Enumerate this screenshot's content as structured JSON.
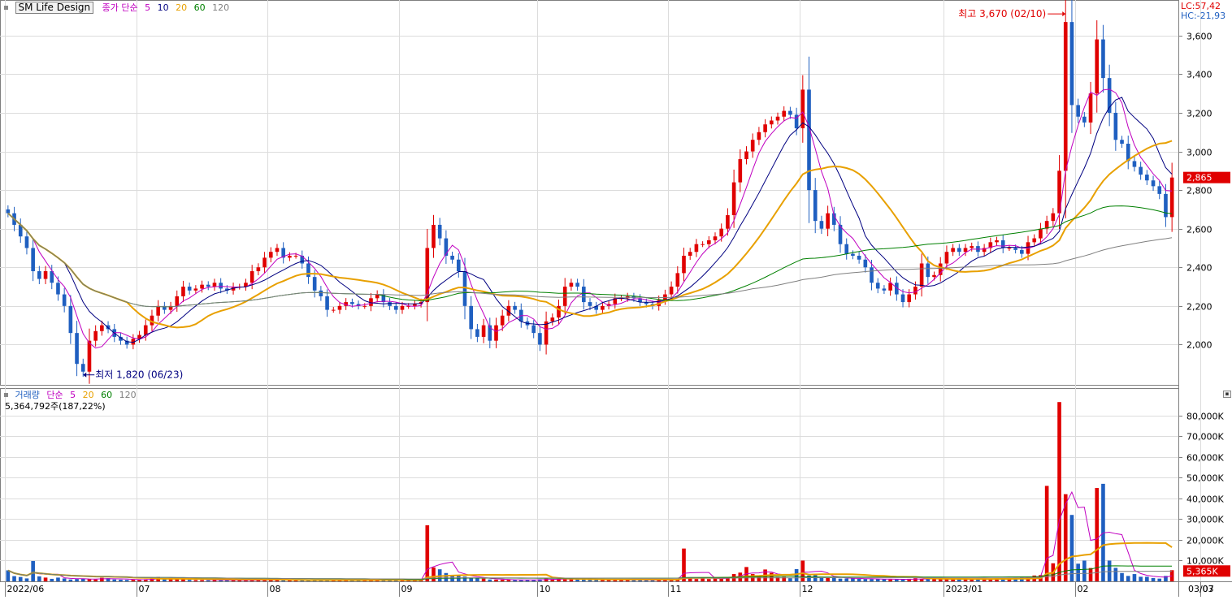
{
  "price_panel": {
    "title": "SM Life Design",
    "ma_label": "종가 단순",
    "ma_periods": [
      "5",
      "10",
      "20",
      "60",
      "120"
    ],
    "ma_colors": [
      "#c000c0",
      "#000080",
      "#e8a000",
      "#008000",
      "#808080"
    ],
    "lc_label": "LC:57,42",
    "hc_label": "HC:-21,93",
    "last_price_label": "2,865",
    "high_annotation": "최고 3,670 (02/10)",
    "low_annotation": "최저 1,820 (06/23)"
  },
  "volume_panel": {
    "title": "거래량",
    "ma_label": "단순",
    "ma_periods": [
      "5",
      "20",
      "60",
      "120"
    ],
    "ma_colors": [
      "#c000c0",
      "#e8a000",
      "#008000",
      "#808080"
    ],
    "volume_summary": "5,364,792주(187,22%)",
    "last_volume_label": "5,365K"
  },
  "colors": {
    "up": "#e00000",
    "down": "#1f5fc0",
    "badge": "#e00000"
  },
  "chart_data": [
    {
      "type": "candlestick",
      "title": "SM Life Design",
      "y_ticks": [
        "3,600",
        "3,400",
        "3,200",
        "3,000",
        "2,800",
        "2,600",
        "2,400",
        "2,200",
        "2,000"
      ],
      "ylim": [
        1800,
        3700
      ],
      "x_tick_labels": [
        "2022/06",
        "07",
        "08",
        "09",
        "10",
        "11",
        "12",
        "2023/01",
        "02",
        "03",
        "03/07"
      ],
      "grid": true,
      "series": [
        {
          "name": "5",
          "values": []
        },
        {
          "name": "10",
          "values": []
        },
        {
          "name": "20",
          "values": []
        },
        {
          "name": "60",
          "values": []
        },
        {
          "name": "120",
          "values": []
        }
      ],
      "close": [
        2680,
        2620,
        2560,
        2500,
        2380,
        2340,
        2380,
        2320,
        2260,
        2200,
        2060,
        1900,
        1860,
        2020,
        2070,
        2100,
        2080,
        2040,
        2020,
        2000,
        2030,
        2050,
        2100,
        2150,
        2200,
        2180,
        2200,
        2250,
        2300,
        2280,
        2290,
        2310,
        2300,
        2320,
        2290,
        2280,
        2300,
        2300,
        2320,
        2380,
        2400,
        2450,
        2480,
        2500,
        2450,
        2460,
        2460,
        2420,
        2350,
        2280,
        2250,
        2180,
        2180,
        2200,
        2220,
        2210,
        2200,
        2200,
        2240,
        2260,
        2220,
        2200,
        2180,
        2200,
        2200,
        2210,
        2220,
        2500,
        2620,
        2550,
        2460,
        2440,
        2380,
        2200,
        2080,
        2040,
        2100,
        2020,
        2100,
        2150,
        2200,
        2180,
        2120,
        2100,
        2060,
        2000,
        2120,
        2140,
        2200,
        2300,
        2320,
        2300,
        2220,
        2200,
        2180,
        2200,
        2210,
        2240,
        2240,
        2250,
        2240,
        2220,
        2210,
        2200,
        2230,
        2260,
        2300,
        2370,
        2460,
        2480,
        2520,
        2520,
        2540,
        2560,
        2600,
        2670,
        2840,
        2960,
        3000,
        3060,
        3100,
        3140,
        3160,
        3180,
        3210,
        3190,
        3120,
        3320,
        2800,
        2640,
        2600,
        2680,
        2620,
        2520,
        2470,
        2460,
        2440,
        2400,
        2320,
        2290,
        2280,
        2320,
        2260,
        2220,
        2260,
        2300,
        2420,
        2350,
        2360,
        2420,
        2480,
        2500,
        2480,
        2500,
        2510,
        2480,
        2500,
        2530,
        2540,
        2500,
        2500,
        2490,
        2470,
        2530,
        2550,
        2600,
        2640,
        2680,
        2900,
        3670,
        3240,
        3180,
        3150,
        3300,
        3580,
        3380,
        3200,
        3060,
        3040,
        2950,
        2920,
        2880,
        2850,
        2820,
        2780,
        2660,
        2865
      ],
      "volume": [
        5300,
        2500,
        2100,
        1400,
        9800,
        2400,
        1800,
        1200,
        1800,
        1400,
        900,
        1100,
        1300,
        1000,
        900,
        1700,
        1500,
        900,
        800,
        700,
        700,
        900,
        1000,
        1300,
        2100,
        1400,
        1600,
        1300,
        1600,
        700,
        600,
        600,
        500,
        900,
        500,
        500,
        600,
        500,
        500,
        700,
        700,
        700,
        600,
        600,
        700,
        500,
        600,
        500,
        600,
        600,
        500,
        500,
        500,
        500,
        500,
        500,
        600,
        700,
        1000,
        1200,
        600,
        700,
        500,
        500,
        500,
        500,
        500,
        27000,
        6700,
        5800,
        4000,
        2900,
        3000,
        2300,
        1500,
        1400,
        1300,
        900,
        800,
        800,
        700,
        600,
        600,
        700,
        700,
        1000,
        1300,
        1000,
        1000,
        1100,
        1200,
        1200,
        1000,
        800,
        900,
        800,
        700,
        700,
        800,
        600,
        600,
        600,
        600,
        600,
        700,
        800,
        900,
        1200,
        15800,
        1900,
        1100,
        1400,
        1100,
        1500,
        1500,
        2000,
        3500,
        4200,
        6900,
        3500,
        2300,
        5700,
        4100,
        2000,
        2100,
        1500,
        5900,
        10000,
        2800,
        3500,
        2200,
        1600,
        1700,
        1300,
        1400,
        1400,
        1200,
        1100,
        1100,
        1100,
        1000,
        900,
        900,
        900,
        1200,
        1500,
        1200,
        1100,
        1100,
        1200,
        1100,
        1300,
        1300,
        1200,
        1200,
        1300,
        1200,
        1200,
        1200,
        1200,
        1200,
        1600,
        1900,
        2000,
        2800,
        3000,
        46000,
        8700,
        86400,
        42000,
        32000,
        8500,
        10000,
        6400,
        45000,
        47000,
        10000,
        6500,
        4000,
        2600,
        3500,
        2200,
        2200,
        1600,
        1300,
        2600,
        5365
      ],
      "volume_y_ticks": [
        "80,000K",
        "70,000K",
        "60,000K",
        "50,000K",
        "40,000K",
        "30,000K",
        "20,000K",
        "10,000K"
      ],
      "volume_ylim": [
        0,
        90000
      ]
    }
  ]
}
